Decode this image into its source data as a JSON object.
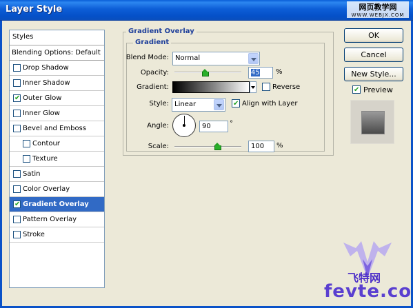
{
  "window": {
    "title": "Layer Style"
  },
  "watermark": {
    "line1": "网页教学网",
    "line2": "WWW.WEBJX.COM",
    "logo_text": "fevte.com",
    "logo_cn": "飞特网"
  },
  "styles_list": {
    "header": "Styles",
    "blending": "Blending Options: Default",
    "items": [
      {
        "label": "Drop Shadow",
        "checked": false,
        "indent": false,
        "selected": false
      },
      {
        "label": "Inner Shadow",
        "checked": false,
        "indent": false,
        "selected": false
      },
      {
        "label": "Outer Glow",
        "checked": true,
        "indent": false,
        "selected": false
      },
      {
        "label": "Inner Glow",
        "checked": false,
        "indent": false,
        "selected": false
      },
      {
        "label": "Bevel and Emboss",
        "checked": false,
        "indent": false,
        "selected": false
      },
      {
        "label": "Contour",
        "checked": false,
        "indent": true,
        "selected": false
      },
      {
        "label": "Texture",
        "checked": false,
        "indent": true,
        "selected": false
      },
      {
        "label": "Satin",
        "checked": false,
        "indent": false,
        "selected": false
      },
      {
        "label": "Color Overlay",
        "checked": false,
        "indent": false,
        "selected": false
      },
      {
        "label": "Gradient Overlay",
        "checked": true,
        "indent": false,
        "selected": true
      },
      {
        "label": "Pattern Overlay",
        "checked": false,
        "indent": false,
        "selected": false
      },
      {
        "label": "Stroke",
        "checked": false,
        "indent": false,
        "selected": false
      }
    ]
  },
  "panel": {
    "outer_title": "Gradient Overlay",
    "inner_title": "Gradient",
    "blend_mode_label": "Blend Mode:",
    "blend_mode_value": "Normal",
    "opacity_label": "Opacity:",
    "opacity_value": "45",
    "opacity_unit": "%",
    "opacity_fraction": 0.45,
    "gradient_label": "Gradient:",
    "reverse_label": "Reverse",
    "reverse_checked": false,
    "style_label": "Style:",
    "style_value": "Linear",
    "align_label": "Align with Layer",
    "align_checked": true,
    "angle_label": "Angle:",
    "angle_value": "90",
    "angle_unit": "°",
    "scale_label": "Scale:",
    "scale_value": "100",
    "scale_unit": "%",
    "scale_fraction": 0.5
  },
  "buttons": {
    "ok": "OK",
    "cancel": "Cancel",
    "new_style": "New Style..."
  },
  "preview": {
    "label": "Preview",
    "checked": true
  },
  "colors": {
    "accent": "#316ac5",
    "title_bar": "#0a5fd8",
    "group_title": "#1e3f9a",
    "checkmark": "#21a121"
  }
}
